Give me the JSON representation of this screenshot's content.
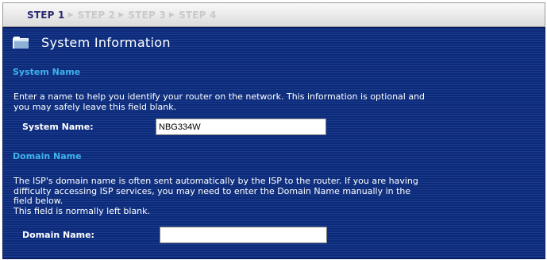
{
  "steps": [
    {
      "label": "STEP 1",
      "active": true
    },
    {
      "label": "STEP 2",
      "active": false
    },
    {
      "label": "STEP 3",
      "active": false
    },
    {
      "label": "STEP 4",
      "active": false
    }
  ],
  "arrow_glyph": "▶",
  "header": {
    "title": "System Information",
    "icon": "folder-icon"
  },
  "system_name_section": {
    "heading": "System Name",
    "description_line1": "Enter a name to help you identify your router on the network. This information is optional and",
    "description_line2": "you may safely leave this field blank.",
    "field_label": "System Name:",
    "field_value": "NBG334W"
  },
  "domain_name_section": {
    "heading": "Domain Name",
    "description_line1": "The ISP's domain name is often sent automatically by the ISP to the router. If you are having",
    "description_line2": "difficulty accessing ISP services, you may need to enter the Domain Name manually in the",
    "description_line3": "field below.",
    "description_line4": "This field is normally left blank.",
    "field_label": "Domain Name:",
    "field_value": ""
  },
  "colors": {
    "panel_background": "#0c2a78",
    "section_heading": "#3fb2ec",
    "active_step": "#2a2a70",
    "inactive_step": "#c9c9c9"
  }
}
